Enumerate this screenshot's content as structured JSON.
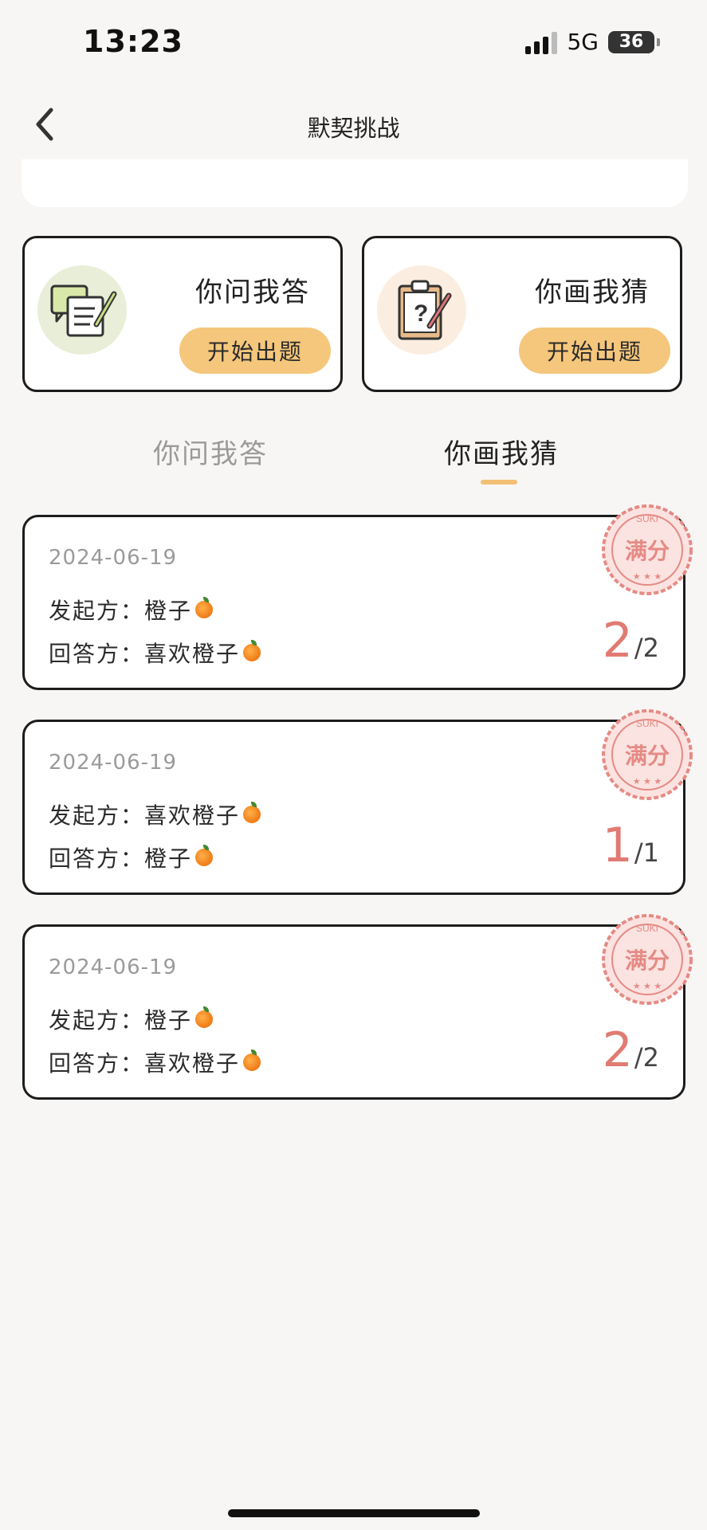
{
  "status_bar": {
    "time": "13:23",
    "network": "5G",
    "battery": "36"
  },
  "nav": {
    "title": "默契挑战"
  },
  "modes": [
    {
      "title": "你问我答",
      "button": "开始出题",
      "icon": "chat-notes-icon"
    },
    {
      "title": "你画我猜",
      "button": "开始出题",
      "icon": "clipboard-question-icon"
    }
  ],
  "tabs": [
    {
      "label": "你问我答",
      "active": false
    },
    {
      "label": "你画我猜",
      "active": true
    }
  ],
  "records": [
    {
      "date": "2024-06-19",
      "initiator_label": "发起方：",
      "initiator": "橙子",
      "answerer_label": "回答方：",
      "answerer": "喜欢橙子",
      "score": "2",
      "total": "/2",
      "stamp": "满分",
      "stamp_sub": "SUKI"
    },
    {
      "date": "2024-06-19",
      "initiator_label": "发起方：",
      "initiator": "喜欢橙子",
      "answerer_label": "回答方：",
      "answerer": "橙子",
      "score": "1",
      "total": "/1",
      "stamp": "满分",
      "stamp_sub": "SUKI"
    },
    {
      "date": "2024-06-19",
      "initiator_label": "发起方：",
      "initiator": "橙子",
      "answerer_label": "回答方：",
      "answerer": "喜欢橙子",
      "score": "2",
      "total": "/2",
      "stamp": "满分",
      "stamp_sub": "SUKI"
    }
  ],
  "colors": {
    "accent": "#f5c77c",
    "score": "#e07b73",
    "stamp": "#e58b85",
    "background": "#f8f6f4"
  }
}
